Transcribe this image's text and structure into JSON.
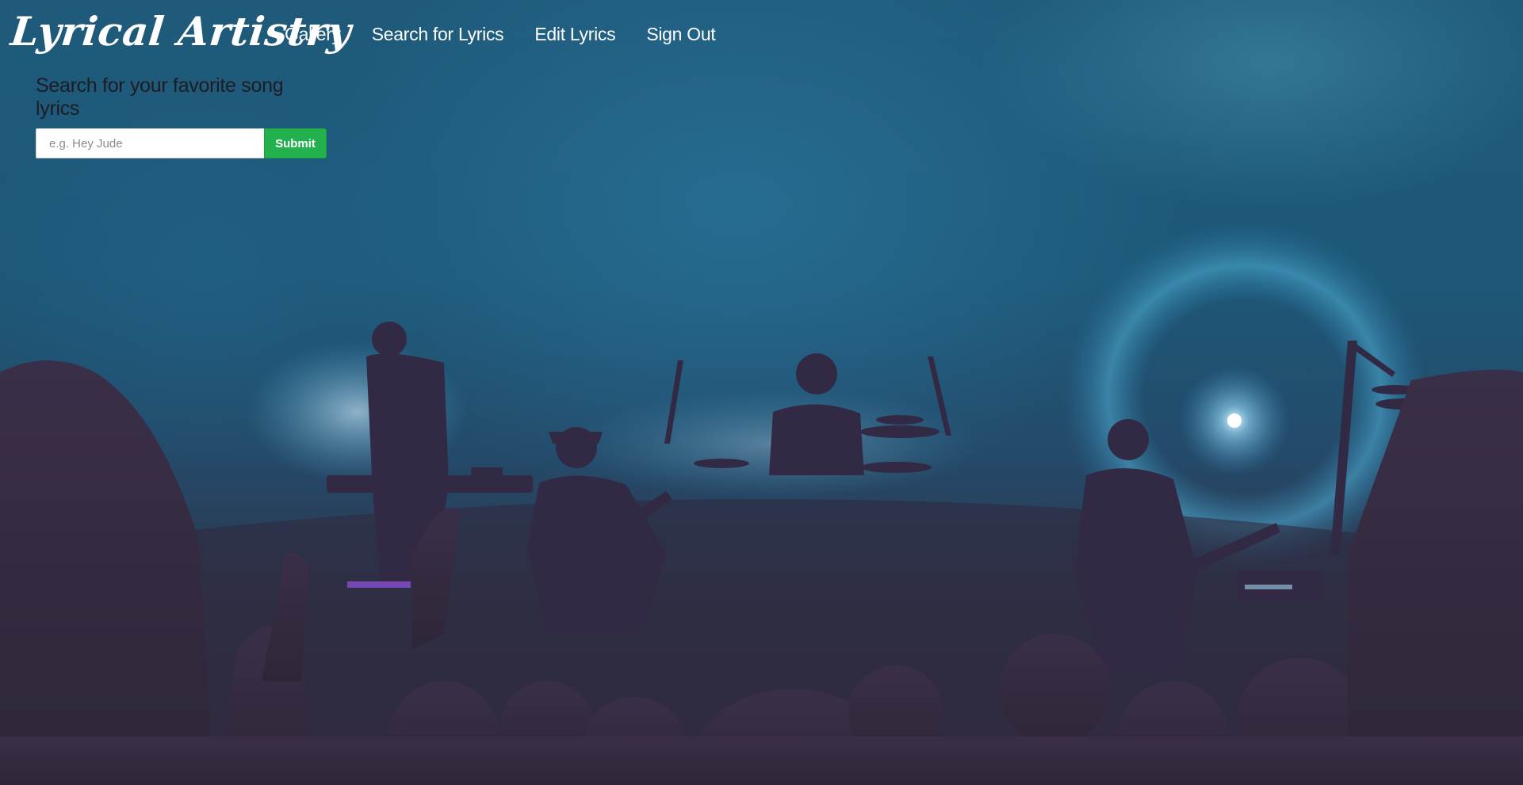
{
  "brand": {
    "title": "Lyrical Artistry"
  },
  "nav": {
    "items": [
      {
        "label": "Gallery"
      },
      {
        "label": "Search for Lyrics"
      },
      {
        "label": "Edit Lyrics"
      },
      {
        "label": "Sign Out"
      }
    ]
  },
  "search": {
    "heading": "Search for your favorite song lyrics",
    "input_value": "",
    "placeholder": "e.g. Hey Jude",
    "submit_label": "Submit"
  },
  "background": {
    "scene": "concert-band-silhouette-image"
  },
  "colors": {
    "accent_button": "#22b14c",
    "nav_text": "#ffffff",
    "heading_text": "#1c1c24"
  }
}
